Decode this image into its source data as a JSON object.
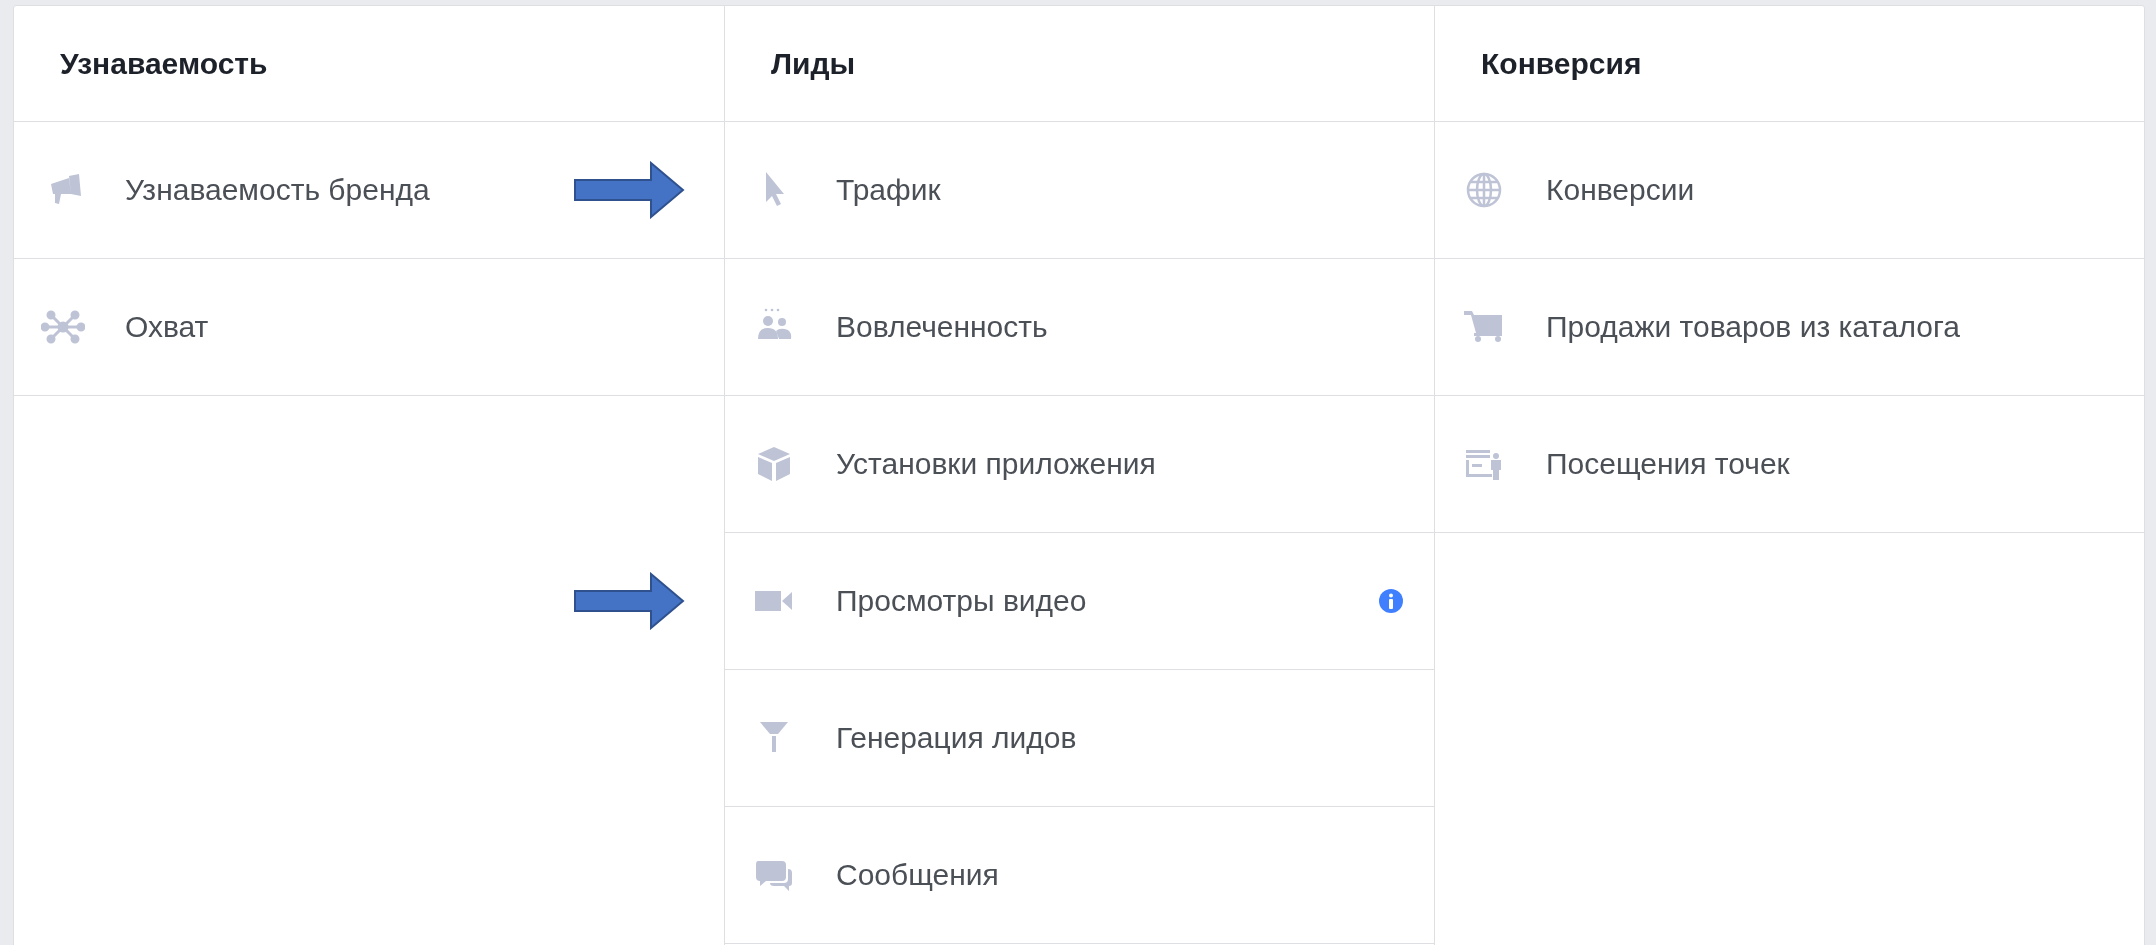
{
  "columns": [
    {
      "title": "Узнаваемость",
      "items": [
        {
          "kind": "megaphone",
          "label": "Узнаваемость бренда",
          "arrow": false,
          "info": false
        },
        {
          "kind": "network",
          "label": "Охват",
          "arrow": false,
          "info": false
        }
      ]
    },
    {
      "title": "Лиды",
      "items": [
        {
          "kind": "cursor",
          "label": "Трафик",
          "arrow": true,
          "info": false
        },
        {
          "kind": "people",
          "label": "Вовлеченность",
          "arrow": false,
          "info": false
        },
        {
          "kind": "cube",
          "label": "Установки приложения",
          "arrow": false,
          "info": false
        },
        {
          "kind": "video",
          "label": "Просмотры видео",
          "arrow": true,
          "info": true
        },
        {
          "kind": "funnel",
          "label": "Генерация лидов",
          "arrow": false,
          "info": false
        },
        {
          "kind": "chat",
          "label": "Сообщения",
          "arrow": false,
          "info": false
        }
      ]
    },
    {
      "title": "Конверсия",
      "items": [
        {
          "kind": "globe",
          "label": "Конверсии",
          "arrow": false,
          "info": false
        },
        {
          "kind": "cart",
          "label": "Продажи товаров из каталога",
          "arrow": false,
          "info": false
        },
        {
          "kind": "store",
          "label": "Посещения точек",
          "arrow": false,
          "info": false
        }
      ]
    }
  ]
}
